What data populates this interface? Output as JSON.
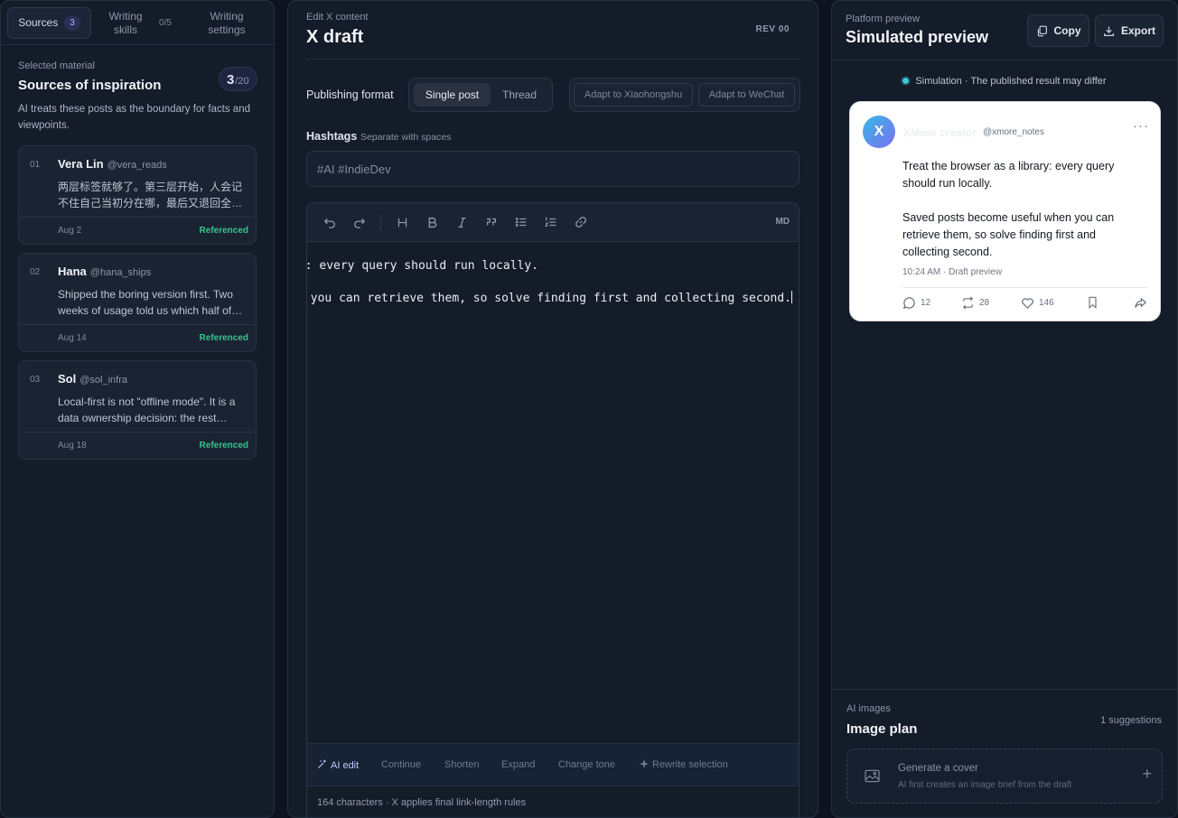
{
  "left": {
    "tabs": [
      {
        "label": "Sources",
        "count": "3"
      },
      {
        "label": "Writing\nskills",
        "count": "0/5"
      },
      {
        "label": "Writing\nsettings"
      }
    ],
    "eyebrow": "Selected material",
    "title": "Sources of inspiration",
    "counter_value": "3",
    "counter_total": "/20",
    "description": "AI treats these posts as the boundary for facts and viewpoints.",
    "sources": [
      {
        "num": "01",
        "name": "Vera Lin",
        "handle": "@vera_reads",
        "excerpt": "两层标签就够了。第三层开始，人会记不住自己当初分在哪，最后又退回全文搜索。",
        "date": "Aug 2",
        "status": "Referenced"
      },
      {
        "num": "02",
        "name": "Hana",
        "handle": "@hana_ships",
        "excerpt": "Shipped the boring version first. Two weeks of usage told us which half of the roadmap actually mattered.",
        "date": "Aug 14",
        "status": "Referenced"
      },
      {
        "num": "03",
        "name": "Sol",
        "handle": "@sol_infra",
        "excerpt": "Local-first is not \"offline mode\". It is a data ownership decision: the rest follows from it.",
        "date": "Aug 18",
        "status": "Referenced"
      }
    ]
  },
  "center": {
    "eyebrow": "Edit X content",
    "title": "X draft",
    "rev": "REV 00",
    "format_label": "Publishing format",
    "formats": [
      "Single post",
      "Thread"
    ],
    "adapt": [
      "Adapt to Xiaohongshu",
      "Adapt to WeChat"
    ],
    "hashtags_label": "Hashtags",
    "hashtags_hint": "Separate with spaces",
    "hashtags_value": "",
    "hashtags_placeholder": "#AI #IndieDev",
    "toolbar_md": "MD",
    "editor_line1": ": every query should run locally.",
    "editor_line2": "you can retrieve them, so solve finding first and collecting second.",
    "ai_actions": [
      "AI edit",
      "Continue",
      "Shorten",
      "Expand",
      "Change tone",
      "Rewrite selection"
    ],
    "char_info": "164 characters · X applies final link-length rules"
  },
  "right": {
    "eyebrow": "Platform preview",
    "title": "Simulated preview",
    "copy_label": "Copy",
    "export_label": "Export",
    "sim_note": "Simulation · The published result may differ",
    "tweet": {
      "avatar": "X",
      "name": "XMore creator",
      "handle": "@xmore_notes",
      "para1": "Treat the browser as a library: every query should run locally.",
      "para2": "Saved posts become useful when you can retrieve them, so solve finding first and collecting second.",
      "meta": "10:24 AM · Draft preview",
      "replies": "12",
      "reposts": "28",
      "likes": "146"
    },
    "images_eyebrow": "AI images",
    "images_title": "Image plan",
    "images_count": "1 suggestions",
    "cover_title": "Generate a cover",
    "cover_sub": "AI first creates an image brief from the draft"
  }
}
